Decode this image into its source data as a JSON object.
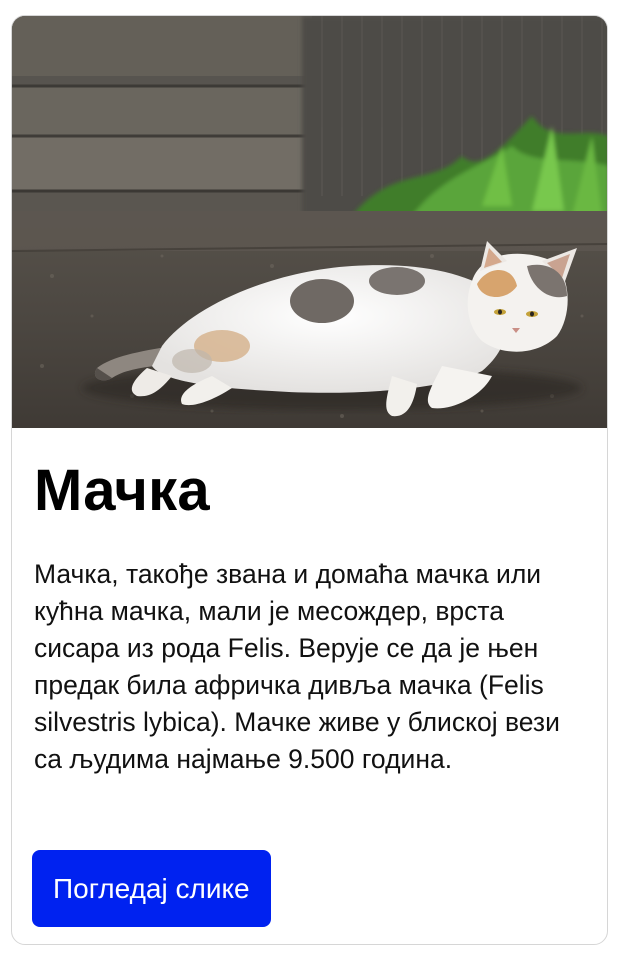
{
  "card": {
    "image": {
      "subject": "cat"
    },
    "title": "Мачка",
    "description": "Мачка, такође звана и домаћа мачка или кућна мачка, мали је месождер, врста сисара из рода Felis. Верује се да је њен предак била афричка дивља мачка (Felis silvestris lybica). Мачке живе у блиској вези са људима најмање 9.500 година.",
    "button_label": "Погледај слике"
  },
  "colors": {
    "button_background": "#0022f0",
    "button_text": "#ffffff",
    "card_border": "#d6d6d6"
  }
}
